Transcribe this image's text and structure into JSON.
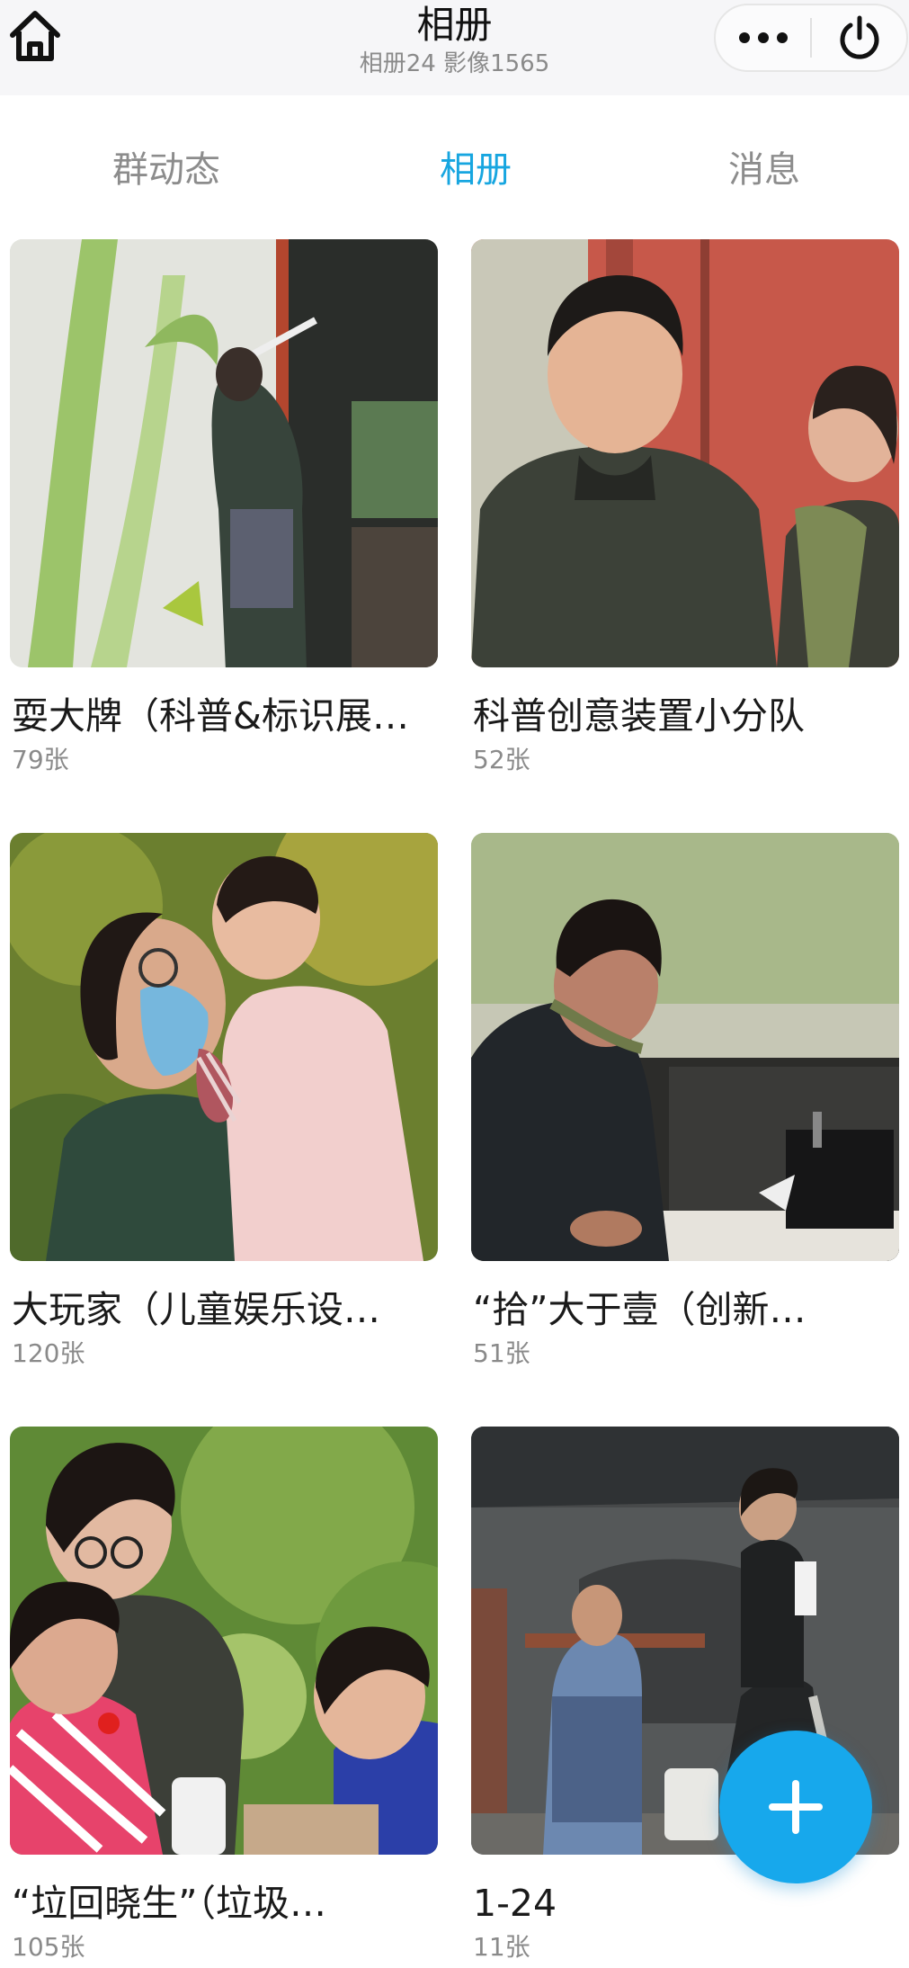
{
  "header": {
    "title": "相册",
    "subtitle": "相册24 影像1565",
    "home_icon": "home-icon",
    "more_icon": "more-dots-icon",
    "close_icon": "power-icon"
  },
  "tabs": [
    {
      "label": "群动态",
      "active": false
    },
    {
      "label": "相册",
      "active": true
    },
    {
      "label": "消息",
      "active": false
    }
  ],
  "colors": {
    "accent": "#17a6e0",
    "tab_active_bg": "#e2f4fc",
    "fab": "#17a8ec",
    "header_bg": "#f6f6f8",
    "muted_text": "#8a8a8a"
  },
  "albums": [
    {
      "name": "耍大牌（科普&标识展…",
      "count": "79张"
    },
    {
      "name": "科普创意装置小分队",
      "count": "52张"
    },
    {
      "name": "大玩家（儿童娱乐设…",
      "count": "120张"
    },
    {
      "name": "“拾”大于壹（创新…",
      "count": "51张"
    },
    {
      "name": "“垃回晓生”（垃圾…",
      "count": "105张"
    },
    {
      "name": "1-24",
      "count": "11张"
    }
  ],
  "fab": {
    "icon": "plus-icon"
  }
}
